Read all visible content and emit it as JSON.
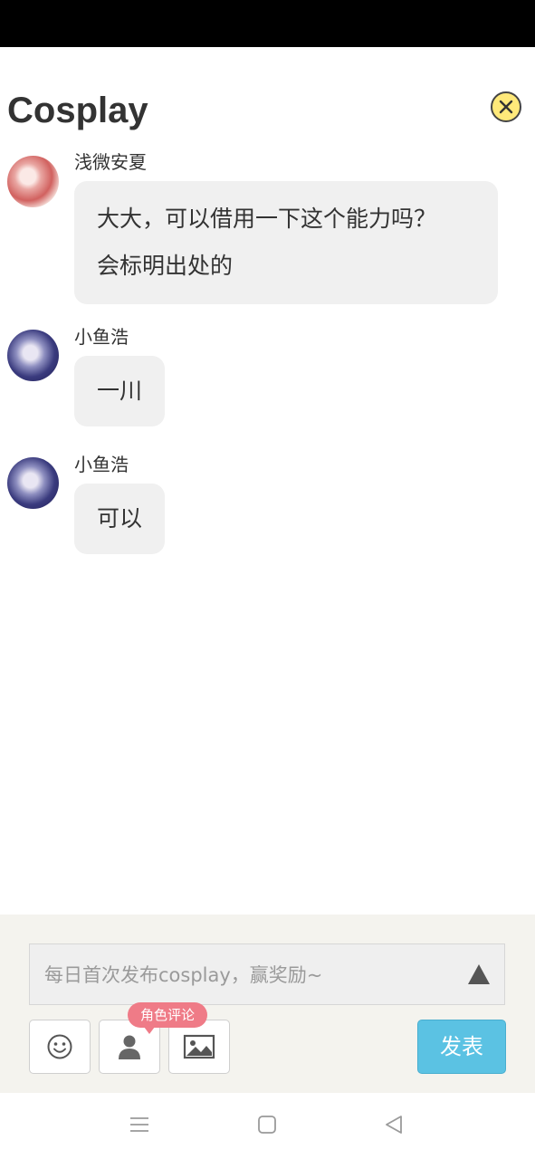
{
  "header": {
    "title": "Cosplay",
    "close_icon": "close-circle-icon"
  },
  "messages": [
    {
      "username": "浅微安夏",
      "avatar": "avatar-pink-anime",
      "lines": [
        "大大，可以借用一下这个能力吗？",
        "会标明出处的"
      ]
    },
    {
      "username": "小鱼浩",
      "avatar": "avatar-blue-anime",
      "lines": [
        "一川"
      ]
    },
    {
      "username": "小鱼浩",
      "avatar": "avatar-blue-anime",
      "lines": [
        "可以"
      ]
    }
  ],
  "composer": {
    "placeholder": "每日首次发布cosplay，赢奖励~",
    "value": "",
    "role_badge": "角色评论",
    "publish_label": "发表",
    "tools": [
      "emoji-icon",
      "person-icon",
      "image-icon"
    ],
    "publish_color": "#5bc2e3",
    "badge_color": "#ef7b87"
  },
  "navbar": {
    "icons": [
      "menu-icon",
      "home-square-icon",
      "back-triangle-icon"
    ]
  }
}
